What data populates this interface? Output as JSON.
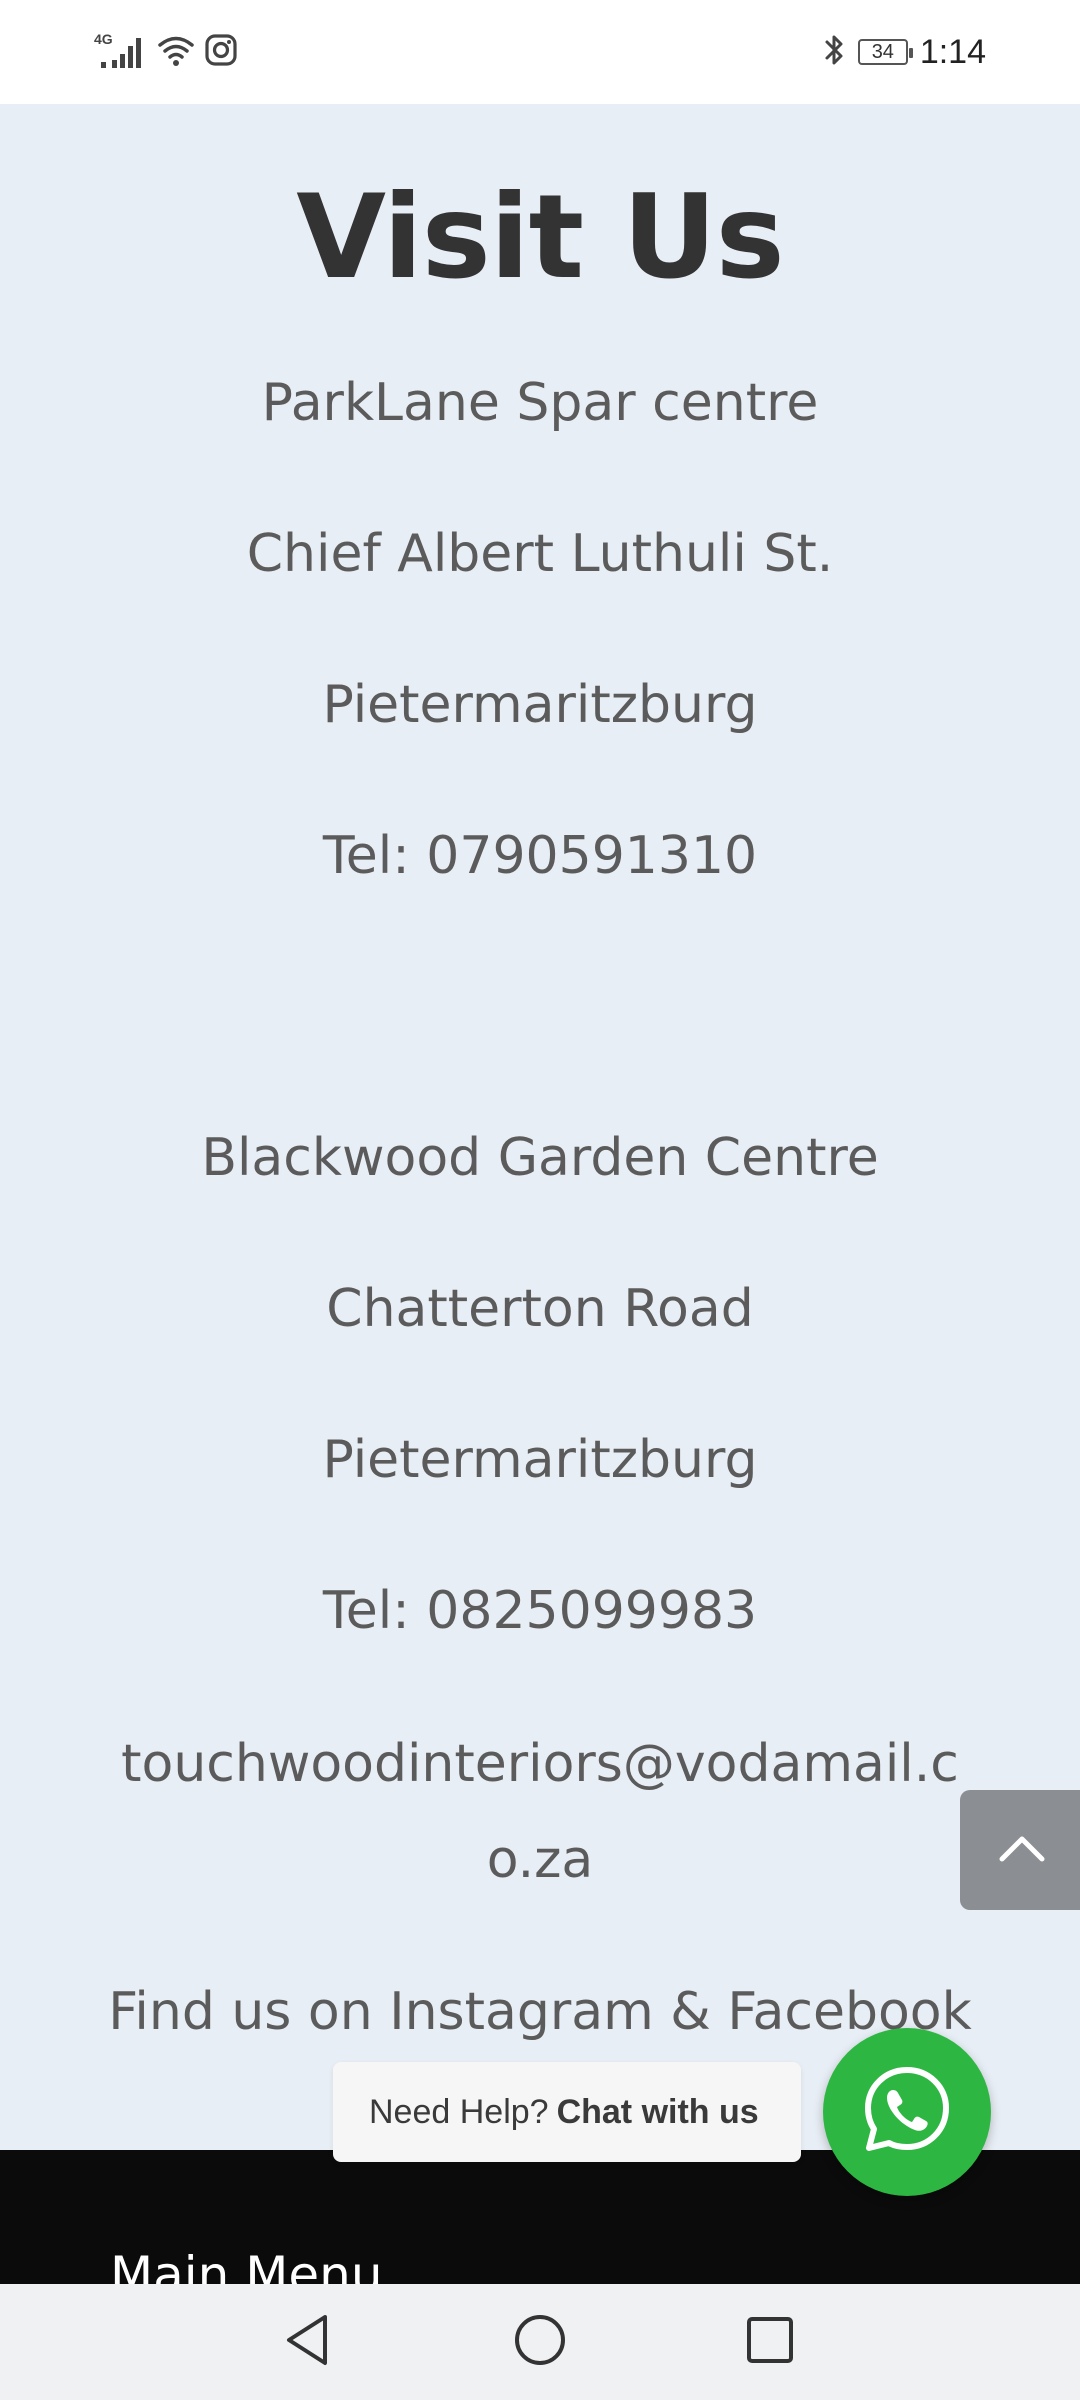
{
  "status_bar": {
    "network": "4G",
    "battery": "34",
    "time": "1:14"
  },
  "page": {
    "heading": "Visit Us",
    "location_1": {
      "name": "ParkLane Spar centre",
      "street": "Chief Albert Luthuli St.",
      "city": "Pietermaritzburg",
      "phone": "Tel: 0790591310"
    },
    "location_2": {
      "name": "Blackwood Garden Centre",
      "street": "Chatterton Road",
      "city": "Pietermaritzburg",
      "phone": "Tel: 0825099983"
    },
    "email": "touchwoodinteriors@vodamail.co.za",
    "social": "Find us on Instagram & Facebook"
  },
  "chat": {
    "prefix": "Need Help?",
    "action": "Chat with us"
  },
  "footer": {
    "title": "Main Menu"
  },
  "icons": {
    "signal": "signal-icon",
    "wifi": "wifi-icon",
    "instagram": "instagram-icon",
    "bluetooth": "bluetooth-icon",
    "battery": "battery-icon",
    "scroll_top": "chevron-up-icon",
    "whatsapp": "whatsapp-icon",
    "back": "back-icon",
    "home": "home-icon",
    "recents": "recents-icon"
  },
  "colors": {
    "background": "#e8eef5",
    "heading": "#333333",
    "text": "#5b5b5b",
    "whatsapp": "#2db742",
    "footer": "#0b0b0b",
    "scroll_top": "#8b8e92"
  }
}
